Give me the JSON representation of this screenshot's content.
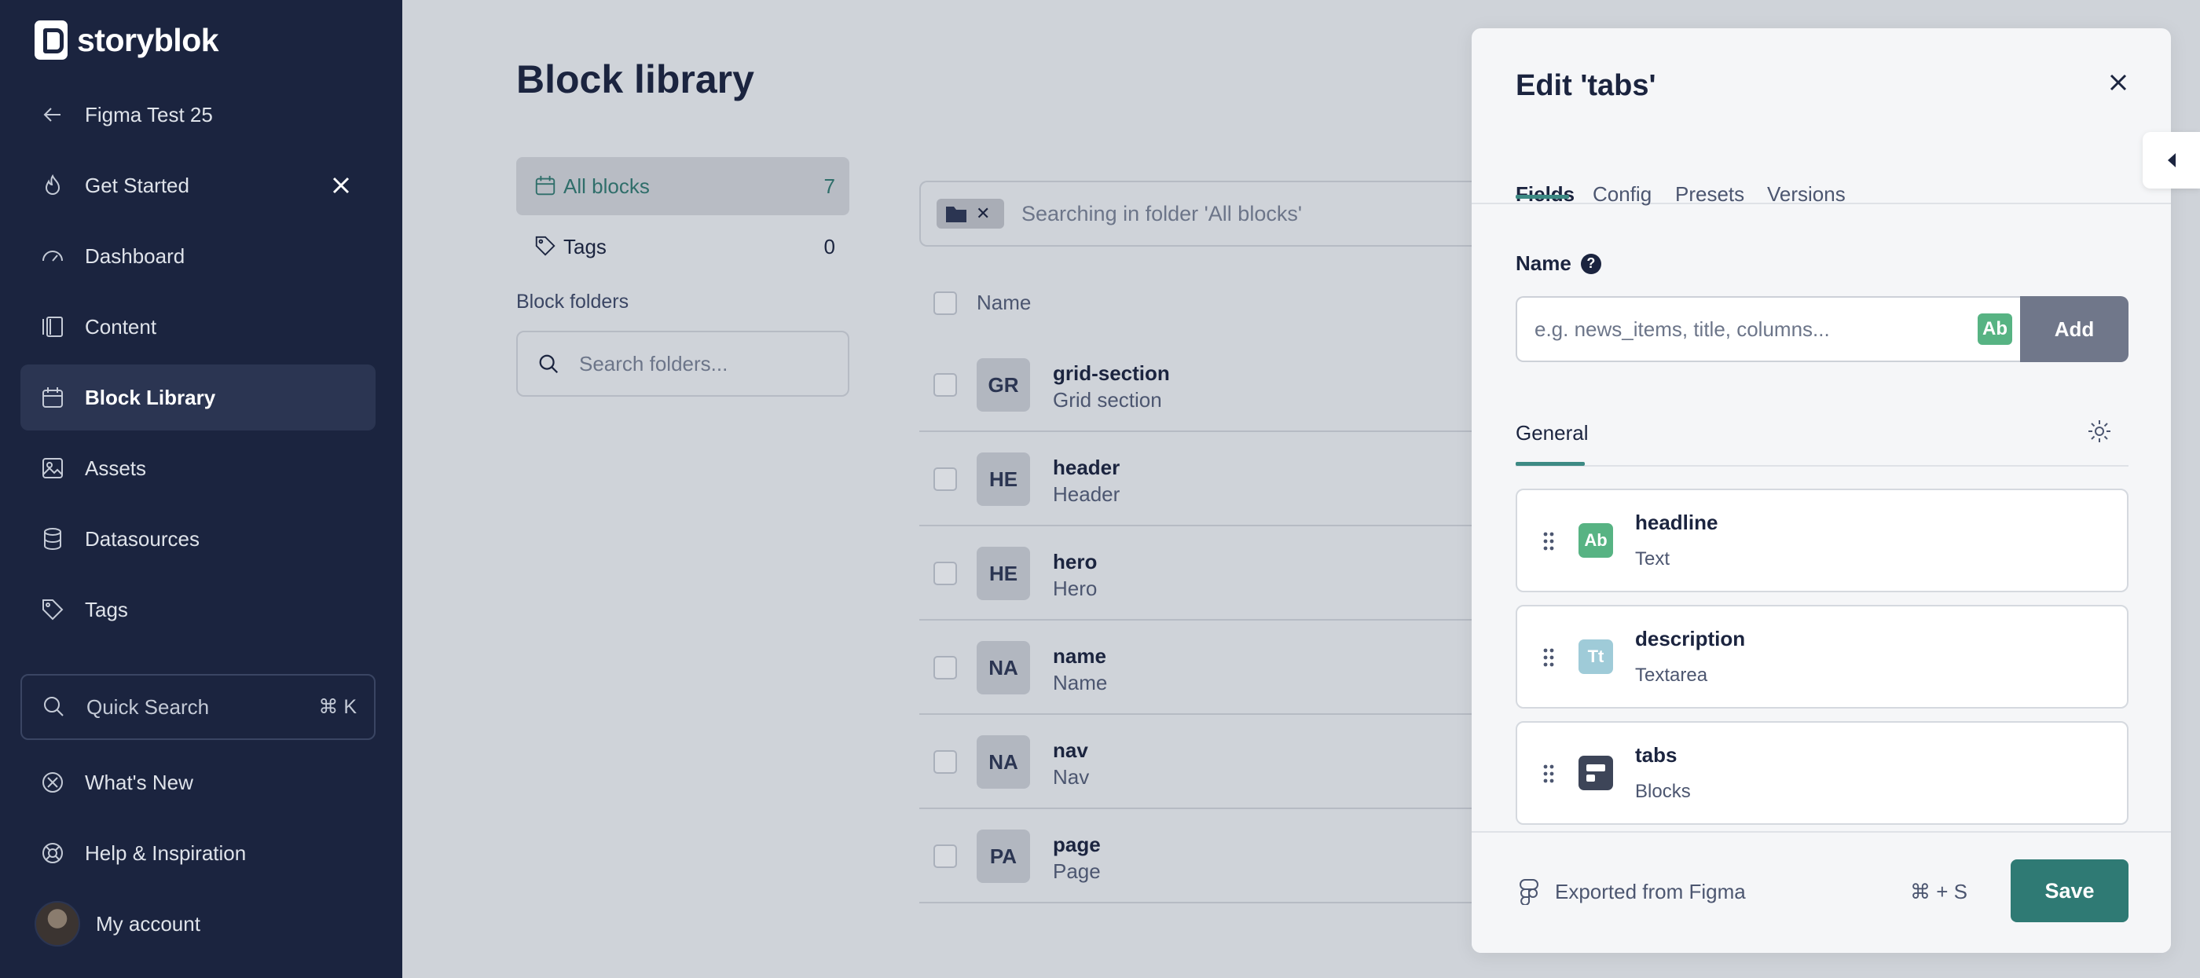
{
  "brand": {
    "name": "storyblok"
  },
  "sidebar": {
    "items": [
      {
        "label": "Figma Test 25",
        "icon": "arrow-left-icon"
      },
      {
        "label": "Get Started",
        "icon": "flame-icon"
      },
      {
        "label": "Dashboard",
        "icon": "gauge-icon"
      },
      {
        "label": "Content",
        "icon": "content-icon"
      },
      {
        "label": "Block Library",
        "icon": "calendar-icon",
        "active": true
      },
      {
        "label": "Assets",
        "icon": "image-icon"
      },
      {
        "label": "Datasources",
        "icon": "database-icon"
      },
      {
        "label": "Tags",
        "icon": "tag-icon"
      }
    ],
    "quick_search": {
      "label": "Quick Search",
      "shortcut": "⌘ K"
    },
    "bottom": [
      {
        "label": "What's New",
        "icon": "sparkle-icon"
      },
      {
        "label": "Help & Inspiration",
        "icon": "lifebuoy-icon"
      },
      {
        "label": "My account",
        "icon": "avatar"
      }
    ]
  },
  "main": {
    "title": "Block library",
    "library_nav": [
      {
        "label": "All blocks",
        "count": "7"
      },
      {
        "label": "Tags",
        "count": "0"
      }
    ],
    "folders_label": "Block folders",
    "folder_search_placeholder": "Search folders...",
    "search_text": "Searching in folder 'All blocks'",
    "columns": {
      "name": "Name"
    },
    "rows": [
      {
        "badge": "GR",
        "name": "grid-section",
        "display": "Grid section"
      },
      {
        "badge": "HE",
        "name": "header",
        "display": "Header"
      },
      {
        "badge": "HE",
        "name": "hero",
        "display": "Hero"
      },
      {
        "badge": "NA",
        "name": "name",
        "display": "Name"
      },
      {
        "badge": "NA",
        "name": "nav",
        "display": "Nav"
      },
      {
        "badge": "PA",
        "name": "page",
        "display": "Page"
      }
    ]
  },
  "drawer": {
    "title": "Edit 'tabs'",
    "tabs": [
      "Fields",
      "Config",
      "Presets",
      "Versions"
    ],
    "name_label": "Name",
    "name_placeholder": "e.g. news_items, title, columns...",
    "type_chip": "Ab",
    "add_label": "Add",
    "section_label": "General",
    "fields": [
      {
        "name": "headline",
        "type": "Text",
        "icon_text": "Ab",
        "color": "#57b383"
      },
      {
        "name": "description",
        "type": "Textarea",
        "icon_text": "Tt",
        "color": "#9fcbd8"
      },
      {
        "name": "tabs",
        "type": "Blocks",
        "icon_text": "",
        "color": "#3d4558"
      }
    ],
    "footer": {
      "note": "Exported from Figma",
      "shortcut": "⌘ + S",
      "save_label": "Save"
    }
  },
  "colors": {
    "sidebar_bg": "#1b243f",
    "accent": "#2f7a74",
    "page_bg": "#cfd3d9"
  }
}
